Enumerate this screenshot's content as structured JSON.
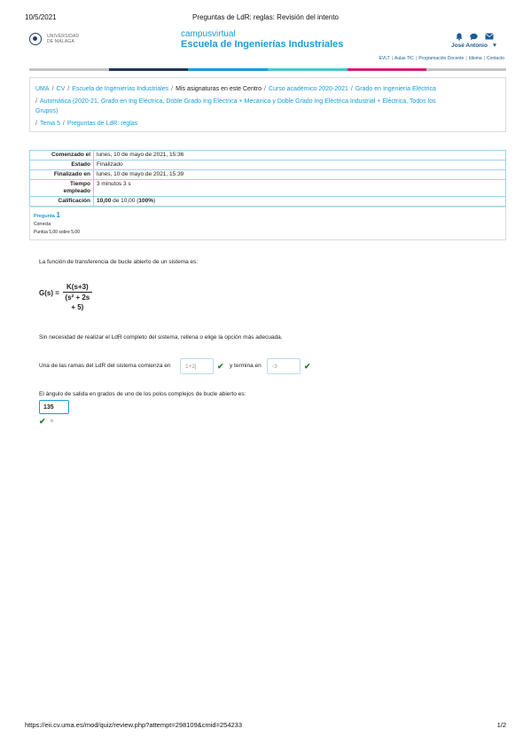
{
  "print_header": {
    "date": "10/5/2021",
    "title": "Preguntas de LdR: reglas: Revisión del intento"
  },
  "logo": {
    "text_line1": "UNIVERSIDAD",
    "text_line2": "DE MÁLAGA"
  },
  "brand": {
    "top": "campusvirtual",
    "main": "Escuela de Ingenierías Industriales"
  },
  "user": {
    "icons": [
      "bell-icon",
      "chat-icon",
      "mail-icon"
    ],
    "name": "José Antonio",
    "dropdown_glyph": "▼"
  },
  "top_links": [
    "EVLT",
    "Aulas TIC",
    "Programación Docente",
    "Idioma",
    "Contacto"
  ],
  "color_bar": [
    "#c4c4c4",
    "#1f3856",
    "#1a9bd7",
    "#4fc3cf",
    "#d81b74",
    "#c4c4c4"
  ],
  "breadcrumbs": {
    "line1": [
      "UMA",
      "CV",
      "Escuela de Ingenierías Industriales",
      "Mis asignaturas en este Centro",
      "Curso académico 2020-2021",
      "Grado en Ingeniería Eléctrica"
    ],
    "line2a": "Automática (2020-21, Grado en Ing Eléctrica, Doble Grado Ing Eléctrica + Mecánica y Doble Grado Ing Eléctrica Industrial + Eléctrica, Todos los",
    "line2b": "Grupos)",
    "line3": [
      "Tema 5",
      "Preguntas de LdR: reglas"
    ]
  },
  "summary": {
    "started_label": "Comenzado el",
    "started_value": "lunes, 10 de mayo de 2021, 15:36",
    "state_label": "Estado",
    "state_value": "Finalizado",
    "finished_label": "Finalizado en",
    "finished_value": "lunes, 10 de mayo de 2021, 15:39",
    "time_label_1": "Tiempo",
    "time_label_2": "empleado",
    "time_value": "3 minutos 3 s",
    "grade_label": "Calificación",
    "grade_score": "10,00",
    "grade_middle": " de 10,00 (",
    "grade_percent": "100%",
    "grade_end": ")"
  },
  "question": {
    "label": "Pregunta",
    "number": "1",
    "state": "Correcta",
    "grade": "Puntúa 5,00 sobre 5,00",
    "intro": "La función de transferencia de bucle abierto de un sistema es:",
    "formula_lhs": "G(s) =",
    "formula_num": "K(s+3)",
    "formula_den": "(s² + 2s + 5)",
    "instruction": "Sin necesidad de realizar el LdR completo del sistema, rellena o elige la opción más adecuada.",
    "branch_prefix": "Una de las ramas del LdR del sistema comienza en",
    "branch_start_value": "1+2j",
    "branch_middle": "y termina en",
    "branch_end_value": "-3",
    "angle_prompt": "El ángulo de salida en grados de uno de los polos complejos de bucle abierto es:",
    "angle_value": "135",
    "degree_mark": "o"
  },
  "print_footer": {
    "url": "https://eii.cv.uma.es/mod/quiz/review.php?attempt=298109&cmid=254233",
    "page": "1/2"
  }
}
